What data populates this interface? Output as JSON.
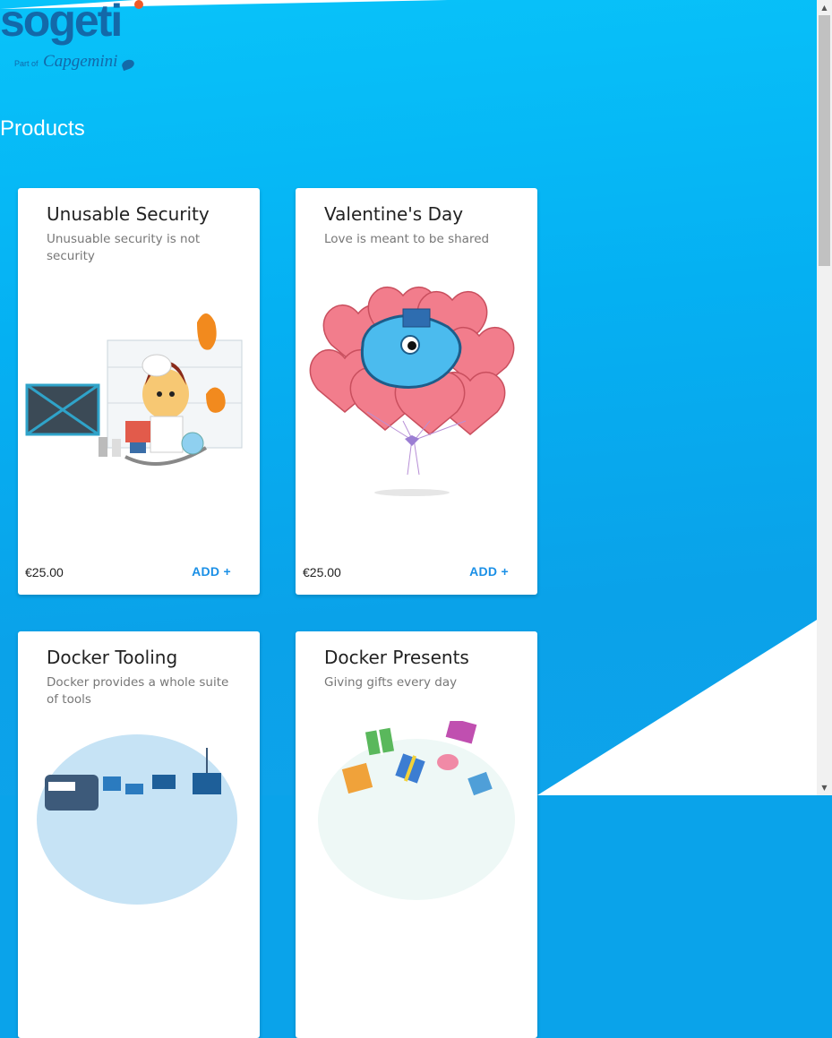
{
  "logo": {
    "brand": "sogeti",
    "part_of": "Part of",
    "parent": "Capgemini"
  },
  "page": {
    "title": "Products"
  },
  "products": [
    {
      "title": "Unusable Security",
      "description": "Unusuable security is not security",
      "price": "€25.00",
      "add_label": "ADD +"
    },
    {
      "title": "Valentine's Day",
      "description": "Love is meant to be shared",
      "price": "€25.00",
      "add_label": "ADD +"
    },
    {
      "title": "Docker Tooling",
      "description": "Docker provides a whole suite of tools",
      "price": "",
      "add_label": ""
    },
    {
      "title": "Docker Presents",
      "description": "Giving gifts every day",
      "price": "",
      "add_label": ""
    }
  ],
  "colors": {
    "accent": "#1a8fe6",
    "brand": "#1369a9",
    "brand_dot": "#f05a28",
    "background": "#08b4f4"
  }
}
